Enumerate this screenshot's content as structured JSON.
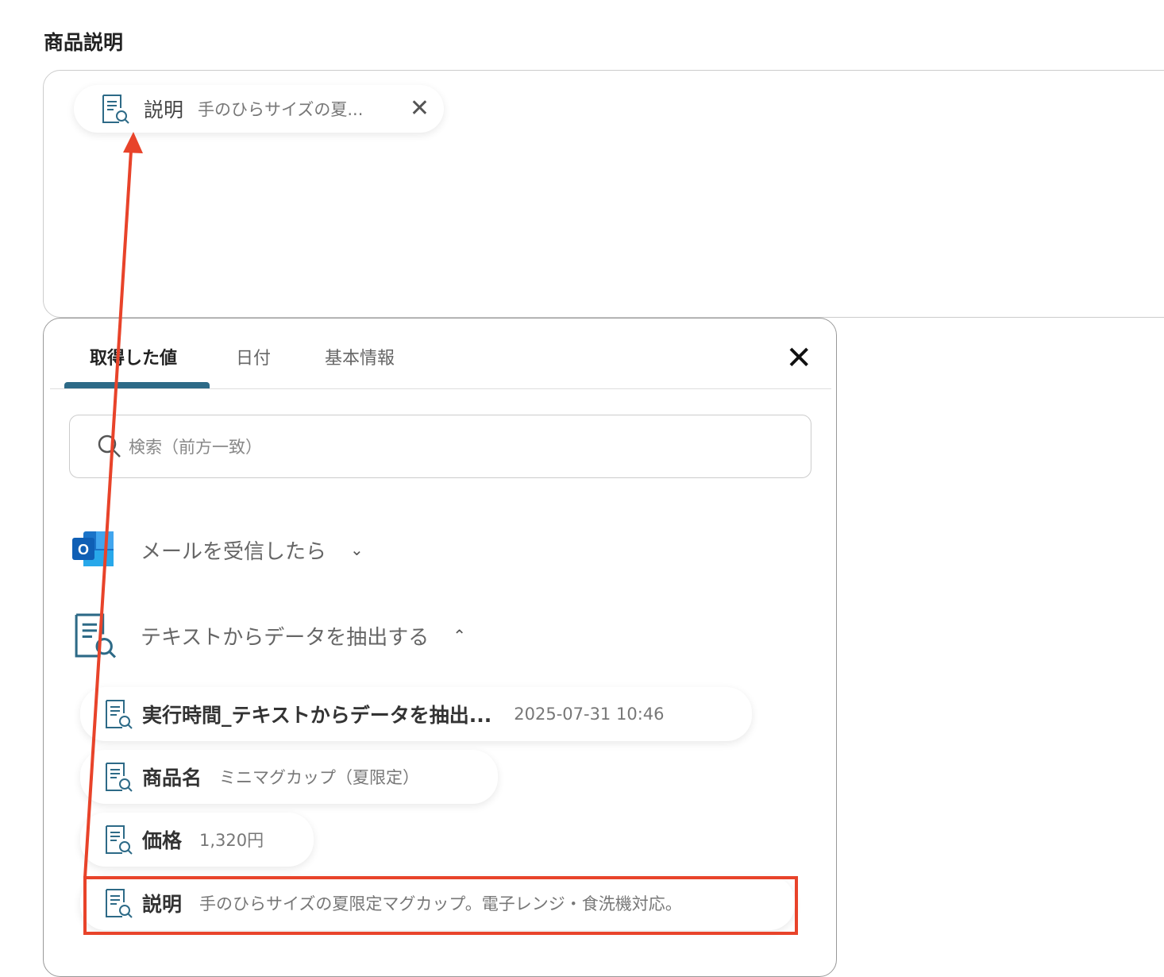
{
  "section_title": "商品説明",
  "selected_chip": {
    "label": "説明",
    "value": "手のひらサイズの夏..."
  },
  "panel": {
    "tabs": [
      {
        "label": "取得した値",
        "active": true
      },
      {
        "label": "日付"
      },
      {
        "label": "基本情報"
      }
    ],
    "search_placeholder": "検索（前方一致）",
    "groups": [
      {
        "label": "メールを受信したら",
        "icon": "outlook-icon",
        "expanded": false
      },
      {
        "label": "テキストからデータを抽出する",
        "icon": "document-search-icon",
        "expanded": true
      }
    ],
    "items": [
      {
        "label": "実行時間_テキストからデータを抽出...",
        "value": "2025-07-31 10:46"
      },
      {
        "label": "商品名",
        "value": "ミニマグカップ（夏限定）"
      },
      {
        "label": "価格",
        "value": "1,320円"
      },
      {
        "label": "説明",
        "value": "手のひらサイズの夏限定マグカップ。電子レンジ・食洗機対応。"
      }
    ]
  },
  "colors": {
    "accent": "#2d6a87",
    "annotation": "#e8432a"
  }
}
